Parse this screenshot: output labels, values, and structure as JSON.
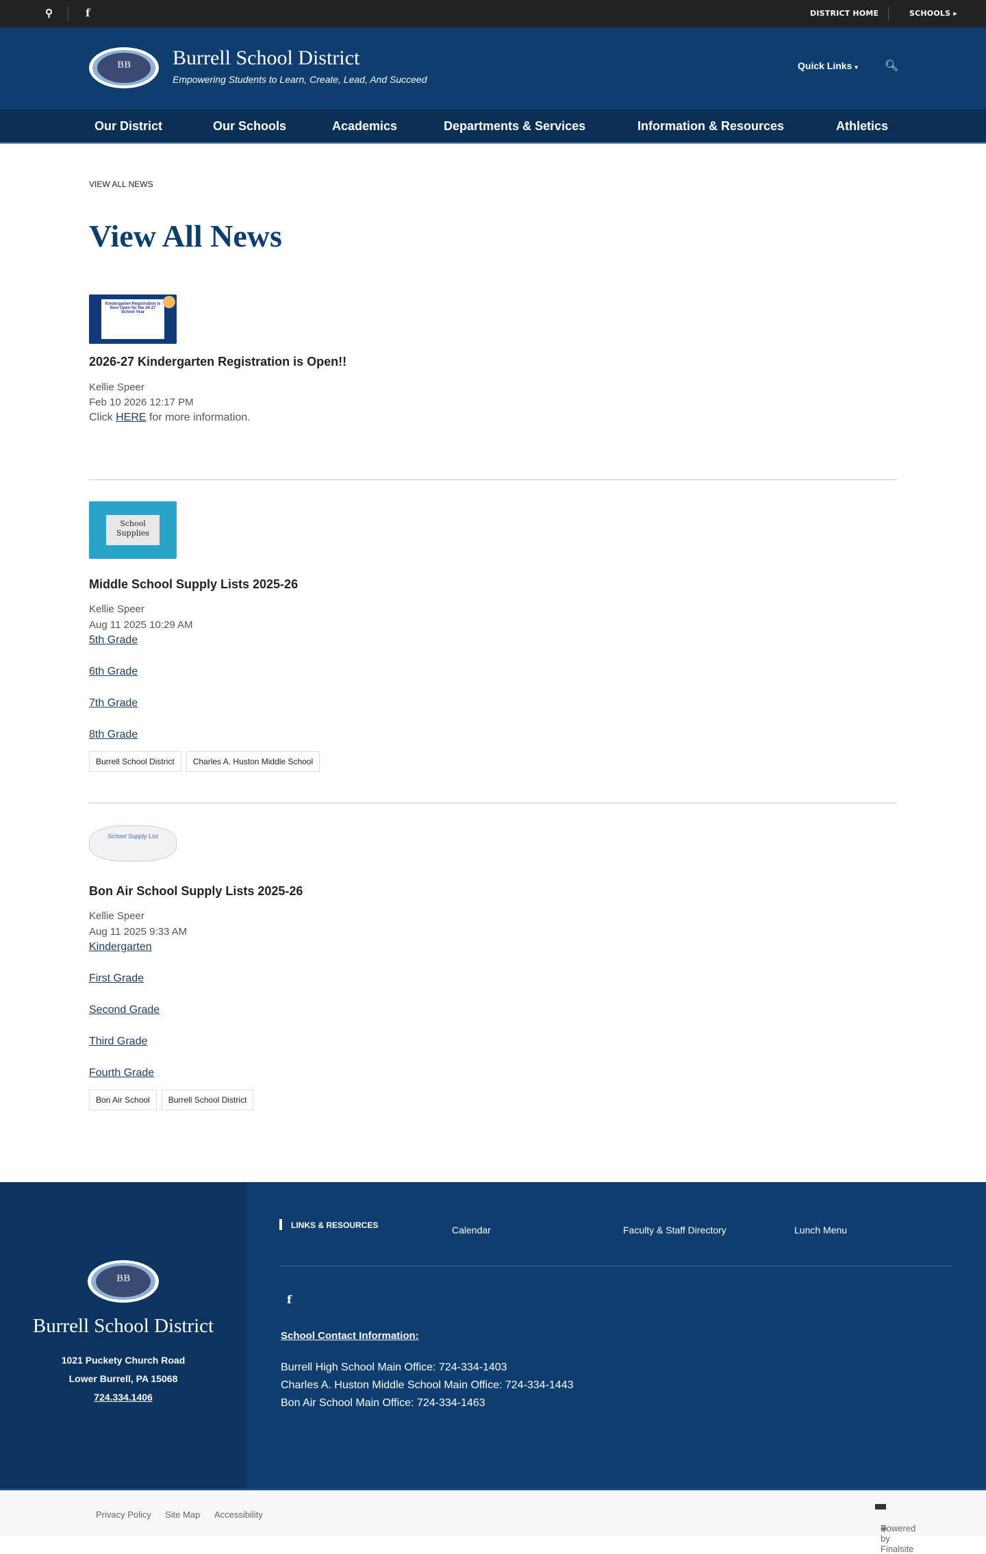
{
  "topbar": {
    "district_home": "DISTRICT HOME",
    "schools": "SCHOOLS"
  },
  "header": {
    "title": "Burrell School District",
    "tagline": "Empowering Students to Learn, Create, Lead, And Succeed",
    "quick_links": "Quick Links",
    "logo_text": "BB"
  },
  "nav": [
    "Our District",
    "Our Schools",
    "Academics",
    "Departments & Services",
    "Information & Resources",
    "Athletics"
  ],
  "breadcrumb": "VIEW ALL NEWS",
  "page_title": "View All News",
  "news": [
    {
      "title": "2026-27 Kindergarten Registration is Open!!",
      "author": "Kellie Speer",
      "date": "Feb 10 2026 12:17 PM",
      "text_pre": "Click ",
      "link": "HERE",
      "text_post": " for more information.",
      "thumb": "Kindergarten Registration Is Now Open for the 26-27 School Year"
    },
    {
      "title": "Middle School Supply Lists 2025-26",
      "author": "Kellie Speer",
      "date": "Aug 11 2025 10:29 AM",
      "links": [
        "5th Grade",
        "6th Grade",
        "7th Grade",
        "8th Grade"
      ],
      "tags": [
        "Burrell School District",
        "Charles A. Huston Middle School"
      ],
      "thumb": "School Supplies"
    },
    {
      "title": "Bon Air School Supply Lists 2025-26",
      "author": "Kellie Speer",
      "date": "Aug 11 2025 9:33 AM",
      "links": [
        "Kindergarten",
        "First Grade",
        "Second Grade ",
        "Third Grade",
        "Fourth Grade"
      ],
      "tags": [
        "Bon Air School",
        "Burrell School District"
      ],
      "thumb": "School Supply List"
    }
  ],
  "footer": {
    "name": "Burrell School District",
    "address1": "1021 Puckety Church Road",
    "address2": "Lower Burrell, PA  15068",
    "phone": "724.334.1406",
    "links_heading": "LINKS & RESOURCES",
    "links": [
      "Calendar",
      "Faculty & Staff Directory",
      "Lunch Menu"
    ],
    "contact_heading": "School Contact Information:",
    "contacts": [
      "Burrell High School Main Office:  724-334-1403",
      "Charles A. Huston Middle School Main Office:  724-334-1443",
      "Bon Air School Main Office:  724-334-1463"
    ]
  },
  "bottom": {
    "links": [
      "Privacy Policy",
      "Site Map",
      "Accessibility"
    ],
    "powered": "Powered by Finalsite"
  },
  "colors": {
    "brand": "#0e3e70",
    "nav": "#0b2f55",
    "topbar": "#222222"
  }
}
